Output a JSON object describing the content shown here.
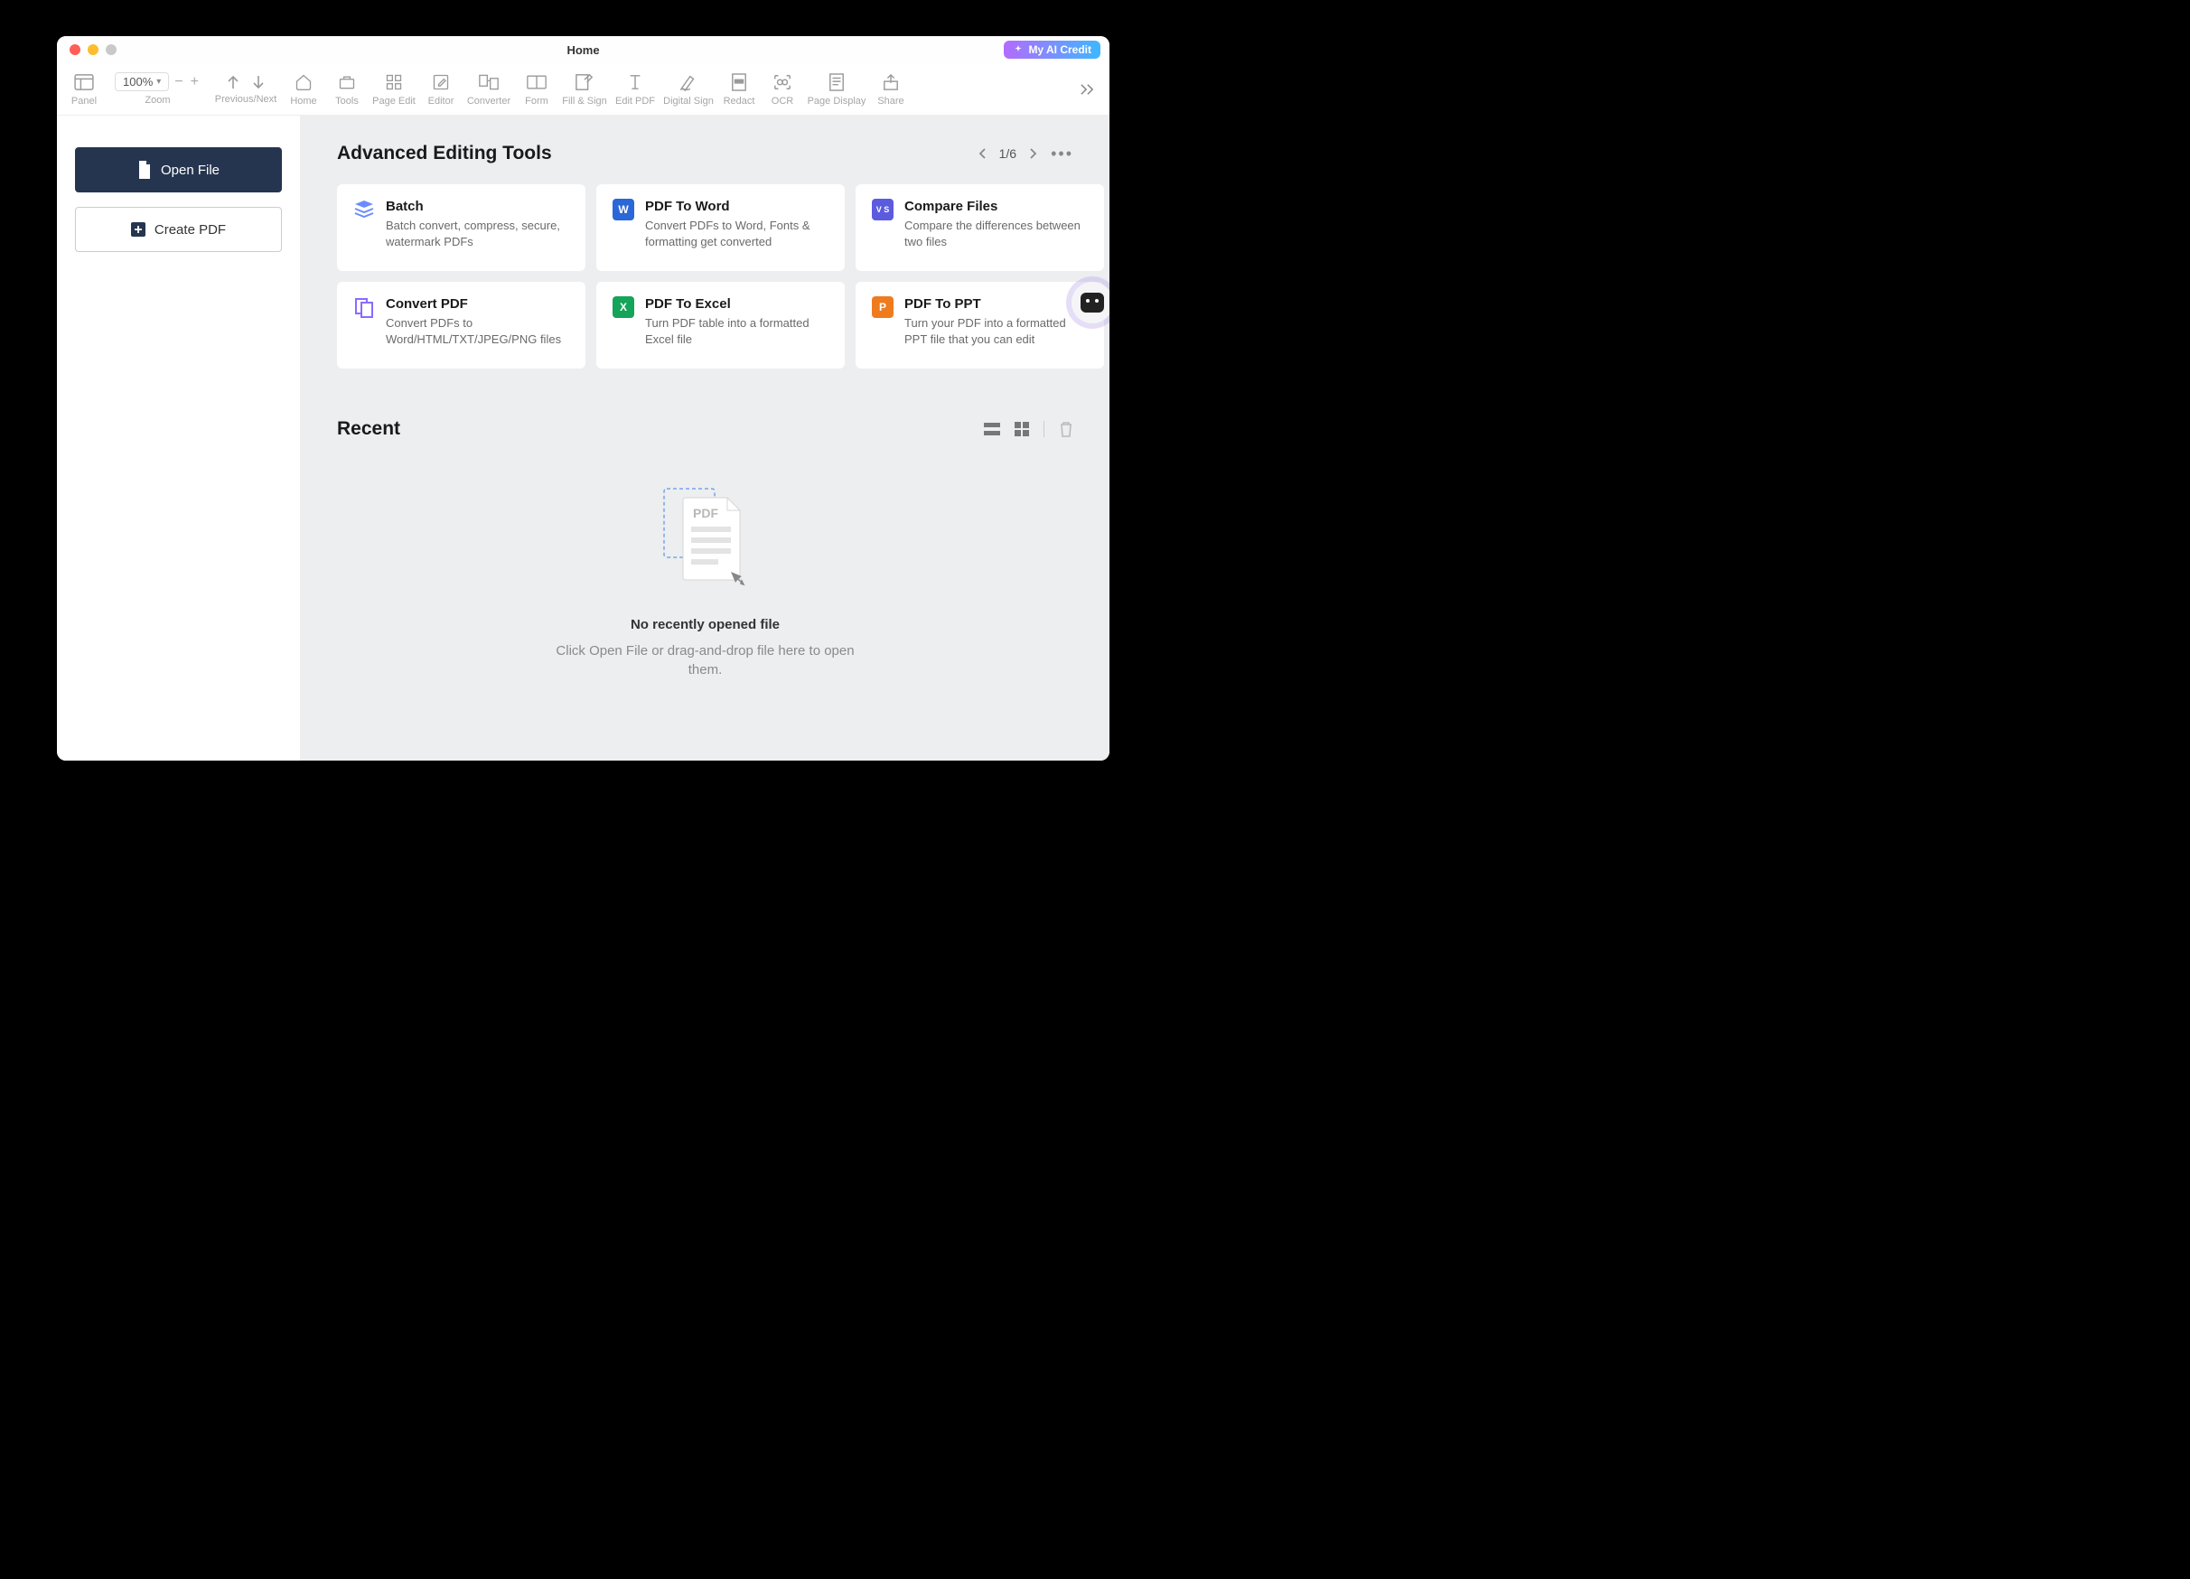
{
  "window": {
    "title": "Home"
  },
  "ai_credit": {
    "label": "My AI Credit"
  },
  "toolbar": {
    "zoom_value": "100%",
    "items": [
      {
        "id": "panel",
        "label": "Panel"
      },
      {
        "id": "zoom",
        "label": "Zoom"
      },
      {
        "id": "previous_next",
        "label": "Previous/Next"
      },
      {
        "id": "home",
        "label": "Home"
      },
      {
        "id": "tools",
        "label": "Tools"
      },
      {
        "id": "page_edit",
        "label": "Page Edit"
      },
      {
        "id": "editor",
        "label": "Editor"
      },
      {
        "id": "converter",
        "label": "Converter"
      },
      {
        "id": "form",
        "label": "Form"
      },
      {
        "id": "fill_sign",
        "label": "Fill & Sign"
      },
      {
        "id": "edit_pdf",
        "label": "Edit PDF"
      },
      {
        "id": "digital_sign",
        "label": "Digital Sign"
      },
      {
        "id": "redact",
        "label": "Redact"
      },
      {
        "id": "ocr",
        "label": "OCR"
      },
      {
        "id": "page_display",
        "label": "Page Display"
      },
      {
        "id": "share",
        "label": "Share"
      }
    ]
  },
  "sidebar": {
    "open_label": "Open File",
    "create_label": "Create PDF"
  },
  "advanced": {
    "heading": "Advanced Editing Tools",
    "page_indicator": "1/6",
    "cards": [
      {
        "title": "Batch",
        "desc": "Batch convert, compress, secure, watermark PDFs",
        "icon": "batch",
        "color": "#6b8cff"
      },
      {
        "title": "PDF To Word",
        "desc": "Convert PDFs to Word, Fonts & formatting get converted",
        "icon": "word",
        "color": "#2a67d8"
      },
      {
        "title": "Compare Files",
        "desc": "Compare the differences between two files",
        "icon": "compare",
        "color": "#5b5be0"
      },
      {
        "title": "Convert PDF",
        "desc": "Convert PDFs to Word/HTML/TXT/JPEG/PNG files",
        "icon": "convert",
        "color": "#8a6bff"
      },
      {
        "title": "PDF To Excel",
        "desc": "Turn PDF table into a formatted Excel file",
        "icon": "excel",
        "color": "#14a45a"
      },
      {
        "title": "PDF To PPT",
        "desc": "Turn your PDF into a formatted PPT file that you can edit",
        "icon": "ppt",
        "color": "#ef7b1f"
      }
    ]
  },
  "recent": {
    "heading": "Recent",
    "empty_title": "No recently opened file",
    "empty_desc": "Click Open File or drag-and-drop file here to open them.",
    "illustration_badge": "PDF"
  }
}
